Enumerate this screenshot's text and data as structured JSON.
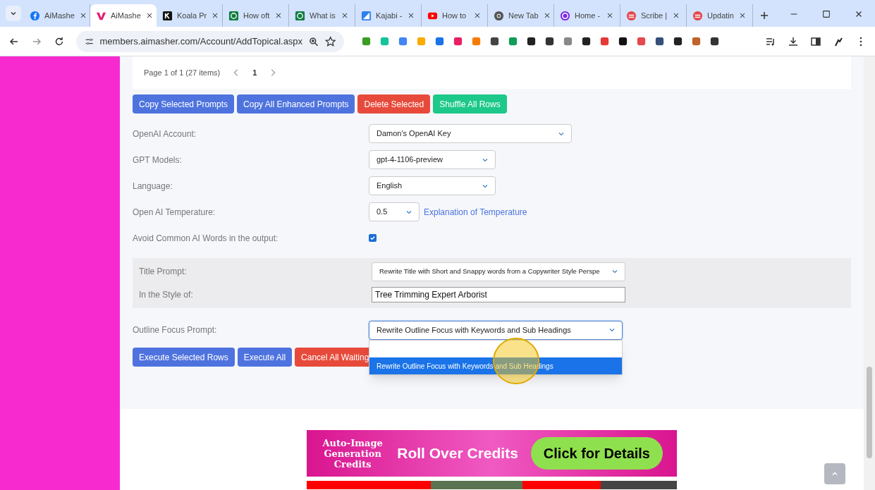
{
  "browser": {
    "tabs": [
      {
        "label": "AiMashe",
        "selected": false
      },
      {
        "label": "AiMashe",
        "selected": true
      },
      {
        "label": "Koala Pr",
        "selected": false
      },
      {
        "label": "How oft",
        "selected": false
      },
      {
        "label": "What is",
        "selected": false
      },
      {
        "label": "Kajabi -",
        "selected": false
      },
      {
        "label": "How to",
        "selected": false
      },
      {
        "label": "New Tab",
        "selected": false
      },
      {
        "label": "Home -",
        "selected": false
      },
      {
        "label": "Scribe |",
        "selected": false
      },
      {
        "label": "Updatin",
        "selected": false
      }
    ],
    "address": "members.aimasher.com/Account/AddTopical.aspx"
  },
  "pager": {
    "summary": "Page 1 of 1 (27 items)",
    "page": "1"
  },
  "actions": [
    {
      "label": "Copy Selected Prompts",
      "kind": "primary"
    },
    {
      "label": "Copy All Enhanced Prompts",
      "kind": "primary"
    },
    {
      "label": "Delete Selected",
      "kind": "danger"
    },
    {
      "label": "Shuffle All Rows",
      "kind": "success"
    }
  ],
  "settings": [
    {
      "label": "OpenAI Account:",
      "kind": "select",
      "value": "Damon's OpenAI Key"
    },
    {
      "label": "GPT Models:",
      "kind": "select",
      "value": "gpt-4-1106-preview"
    },
    {
      "label": "Language:",
      "kind": "select",
      "value": "English"
    },
    {
      "label": "Open AI Temperature:",
      "kind": "select",
      "value": "0.5",
      "link": "Explanation of Temperature"
    },
    {
      "label": "Avoid Common AI Words in the output:",
      "kind": "checkbox",
      "checked": true
    }
  ],
  "title_section": [
    {
      "label": "Title Prompt:",
      "kind": "select",
      "value": "Rewrite Title with Short and Snappy words from a Copywriter Style Perspe"
    },
    {
      "label": "In the Style of:",
      "kind": "text",
      "value": "Tree Trimming Expert Arborist"
    }
  ],
  "outline": {
    "label": "Outline Focus Prompt:",
    "value": "Rewrite Outline Focus with Keywords and Sub Headings",
    "expanded": true,
    "options": [
      {
        "selected": false
      },
      {
        "label": "Rewrite Outline Focus with Keywords and Sub Headings",
        "selected": true
      }
    ]
  },
  "execute": [
    {
      "label": "Execute Selected Rows",
      "kind": "primary"
    },
    {
      "label": "Execute All",
      "kind": "primary"
    },
    {
      "label": "Cancel All Waiting",
      "kind": "danger"
    }
  ],
  "banner": {
    "left": "Auto-Image Generation Credits",
    "middle": "Roll Over Credits",
    "cta": "Click for Details"
  }
}
